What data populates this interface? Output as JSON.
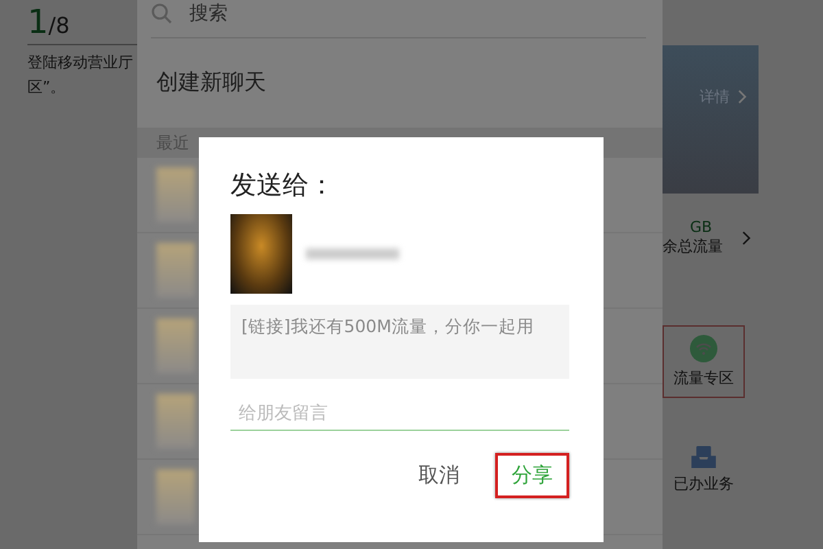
{
  "left_panel": {
    "step": "1",
    "step_total": "/8",
    "description_lines": [
      "登陆移动营业厅",
      "区”。"
    ]
  },
  "share_screen": {
    "search": {
      "placeholder": "搜索"
    },
    "create_chat": "创建新聊天",
    "section_header": "最近",
    "contacts": [
      {
        "kind": "blurred"
      },
      {
        "kind": "blurred"
      },
      {
        "kind": "blurred"
      },
      {
        "kind": "blurred"
      },
      {
        "kind": "blurred"
      }
    ]
  },
  "right_panel": {
    "banner_link": "详情",
    "data_amount": "GB",
    "data_label": "余总流量",
    "highlighted_item": {
      "label": "流量专区",
      "highlighted": true
    },
    "done_item": {
      "label": "已办业务"
    }
  },
  "dialog": {
    "title": "发送给：",
    "message": "[链接]我还有500M流量，分你一起用",
    "comment": {
      "placeholder": "给朋友留言"
    },
    "buttons": [
      {
        "label": "取消",
        "kind": "cancel",
        "highlighted": false
      },
      {
        "label": "分享",
        "kind": "primary",
        "highlighted": true
      }
    ]
  }
}
